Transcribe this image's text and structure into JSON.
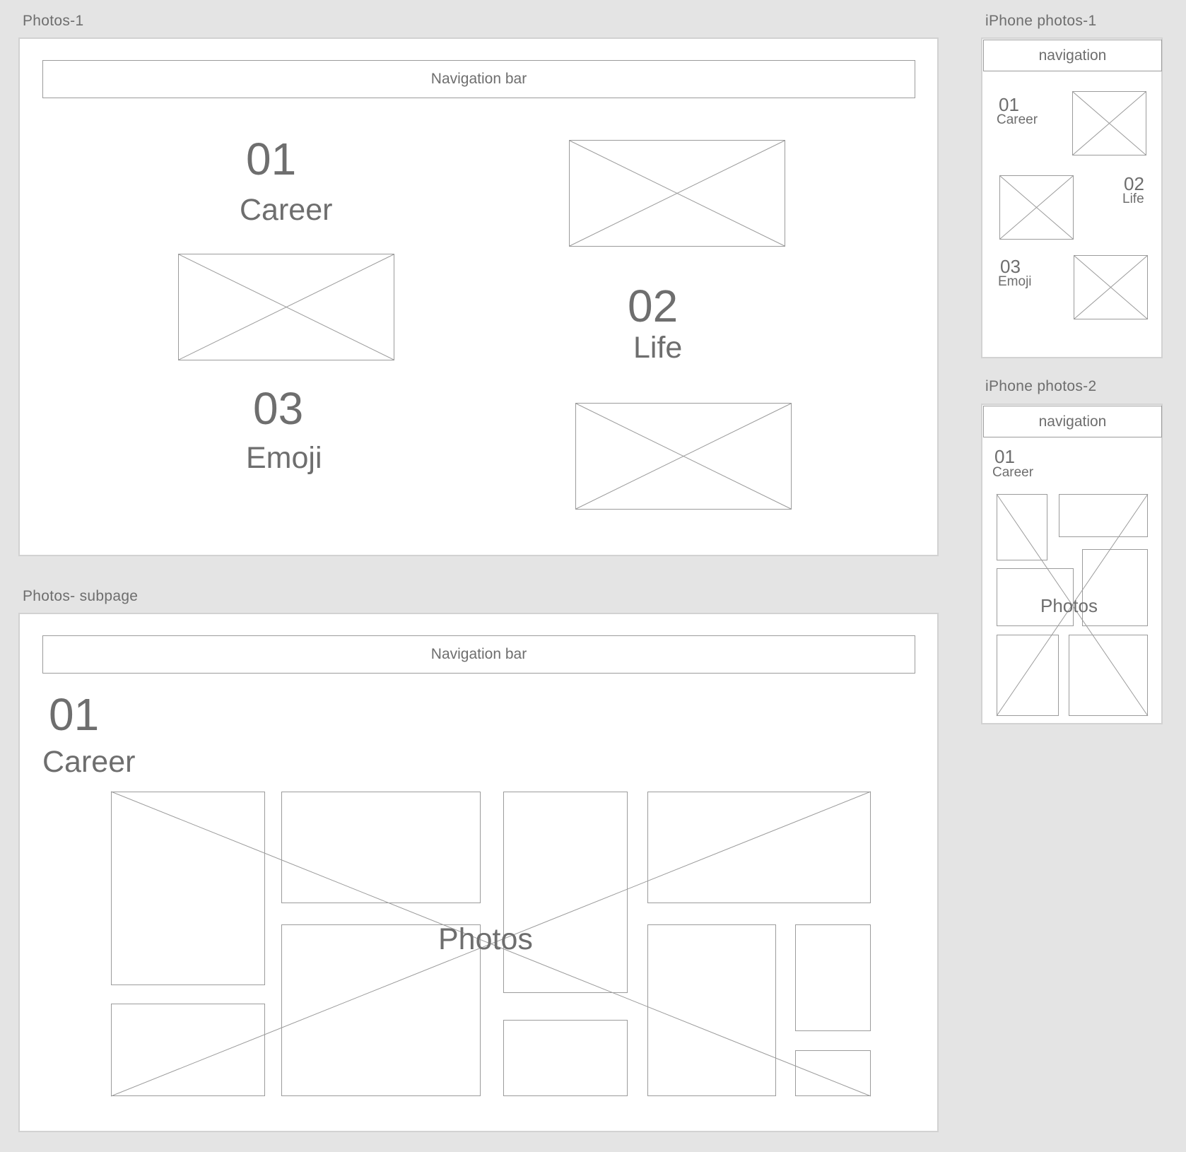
{
  "frames": {
    "photos1": {
      "label": "Photos-1",
      "navbar": "Navigation bar",
      "items": [
        {
          "num": "01",
          "title": "Career"
        },
        {
          "num": "02",
          "title": "Life"
        },
        {
          "num": "03",
          "title": "Emoji"
        }
      ]
    },
    "subpage": {
      "label": "Photos- subpage",
      "navbar": "Navigation bar",
      "num": "01",
      "title": "Career",
      "photos_label": "Photos"
    },
    "iphone1": {
      "label": "iPhone photos-1",
      "navbar": "navigation",
      "items": [
        {
          "num": "01",
          "title": "Career"
        },
        {
          "num": "02",
          "title": "Life"
        },
        {
          "num": "03",
          "title": "Emoji"
        }
      ]
    },
    "iphone2": {
      "label": "iPhone photos-2",
      "navbar": "navigation",
      "num": "01",
      "title": "Career",
      "photos_label": "Photos"
    }
  },
  "colors": {
    "canvas": "#e4e4e4",
    "artboard": "#ffffff",
    "stroke": "#9b9b9b",
    "text": "#6e6e6e"
  },
  "icons": {
    "placeholder": "image-placeholder-x-icon"
  }
}
